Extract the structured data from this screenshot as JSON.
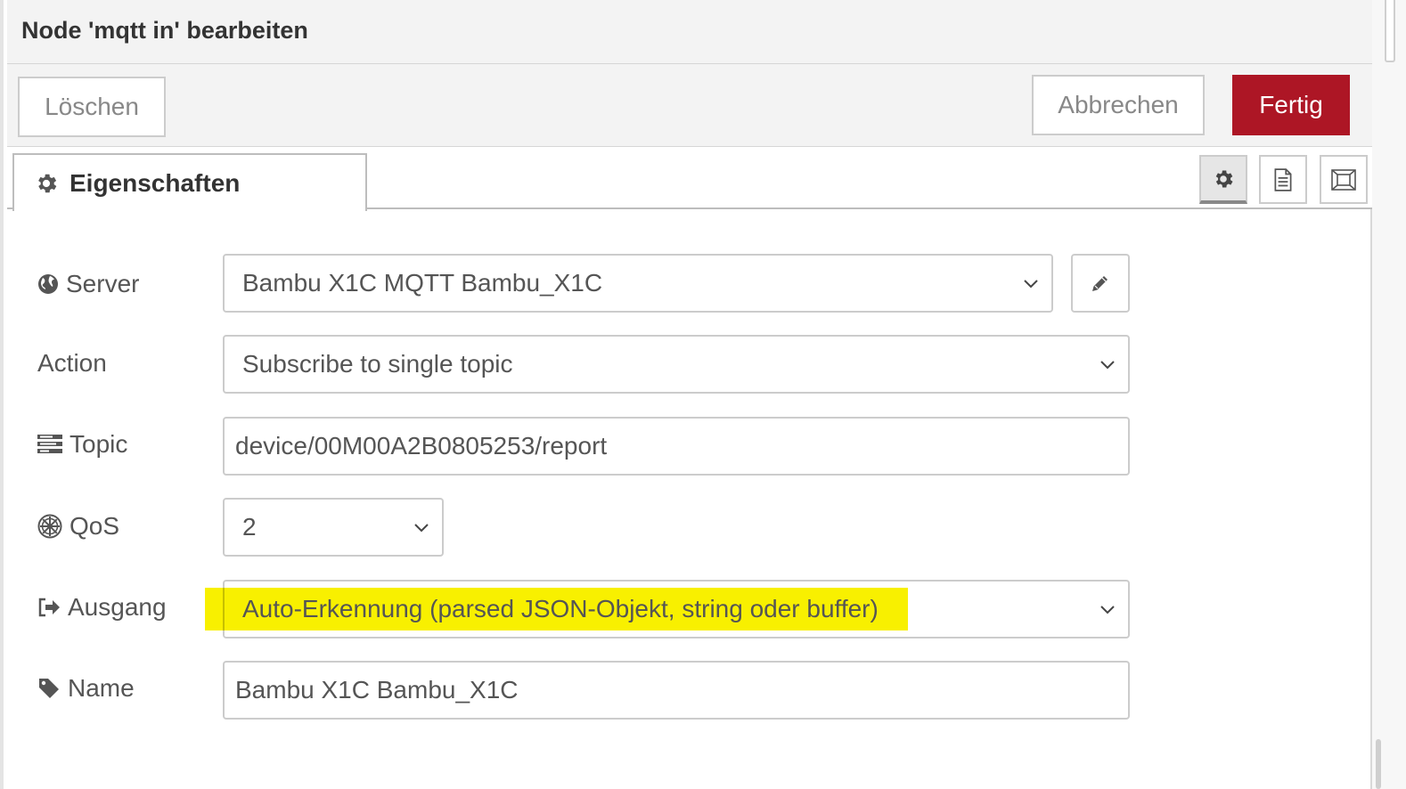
{
  "dialog": {
    "title": "Node 'mqtt in' bearbeiten"
  },
  "toolbar": {
    "delete_label": "Löschen",
    "cancel_label": "Abbrechen",
    "done_label": "Fertig"
  },
  "tabs": {
    "properties_label": "Eigenschaften",
    "buttons": [
      "gear-icon",
      "description-icon",
      "appearance-icon"
    ]
  },
  "form": {
    "server": {
      "label": "Server",
      "value": "Bambu X1C MQTT Bambu_X1C"
    },
    "action": {
      "label": "Action",
      "value": "Subscribe to single topic"
    },
    "topic": {
      "label": "Topic",
      "value": "device/00M00A2B0805253/report"
    },
    "qos": {
      "label": "QoS",
      "value": "2"
    },
    "output": {
      "label": "Ausgang",
      "value": "Auto-Erkennung (parsed JSON-Objekt, string oder buffer)"
    },
    "name": {
      "label": "Name",
      "value": "Bambu X1C Bambu_X1C"
    }
  },
  "colors": {
    "done_button": "#ad1625",
    "highlight": "#f8f000"
  }
}
